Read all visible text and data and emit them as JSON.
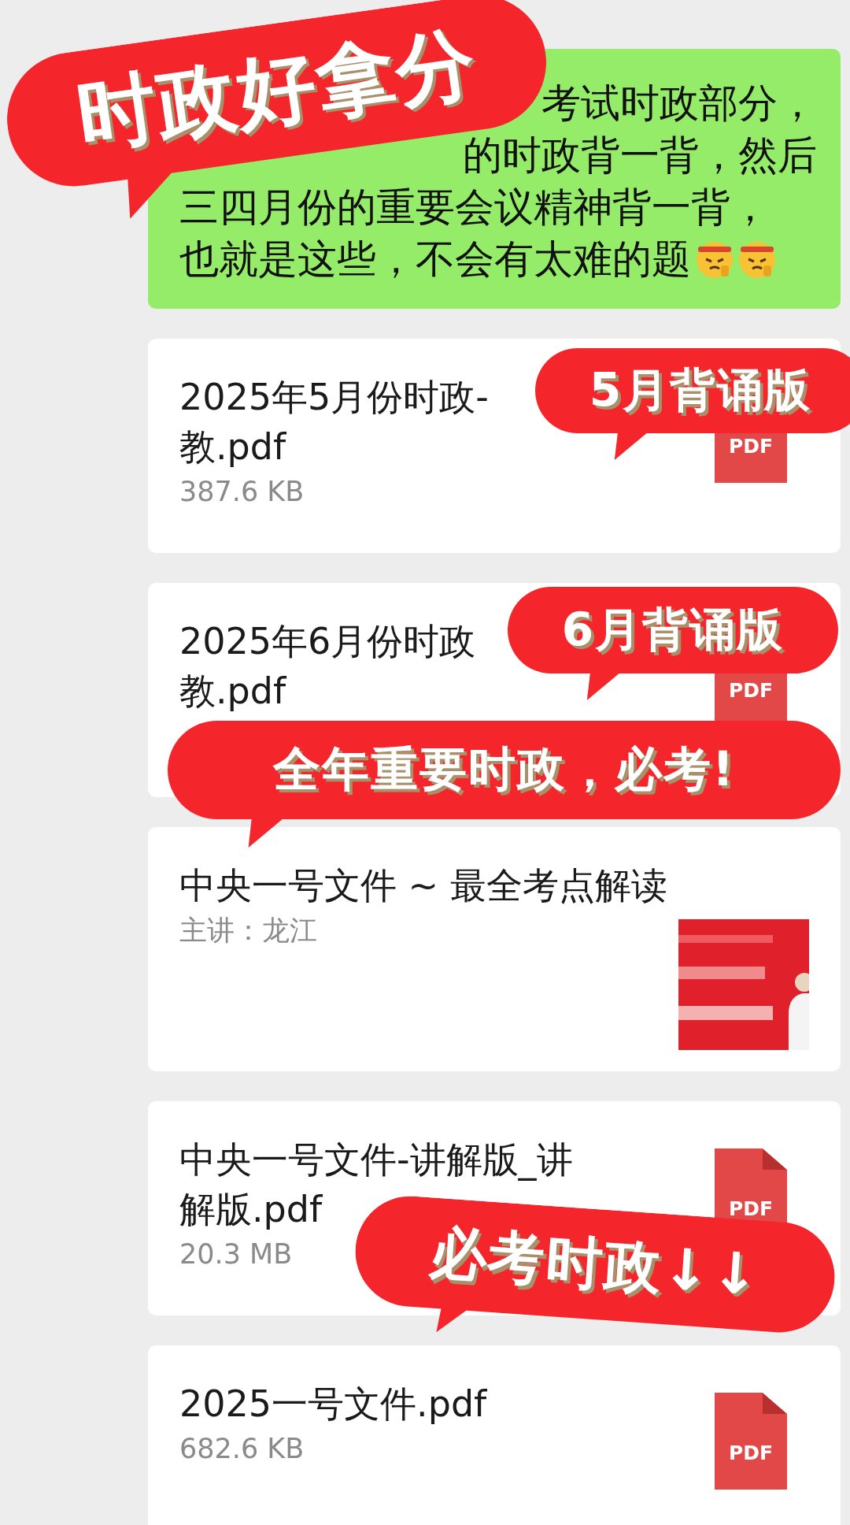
{
  "message": {
    "lines": [
      "考试时政部分，",
      "的时政背一背，然后",
      "三四月份的重要会议精神背一背，",
      "也就是这些，不会有太难的题"
    ]
  },
  "files": [
    {
      "kind": "pdf",
      "title_lines": [
        "2025年5月份时政-",
        "教.pdf"
      ],
      "size": "387.6 KB",
      "icon_label": "PDF"
    },
    {
      "kind": "pdf",
      "title_lines": [
        "2025年6月份时政",
        "教.pdf"
      ],
      "icon_label": "PDF"
    },
    {
      "kind": "link",
      "title_lines": [
        "中央一号文件 ~ 最全考点解读"
      ],
      "subtitle": "主讲：龙江"
    },
    {
      "kind": "pdf",
      "title_lines": [
        "中央一号文件-讲解版_讲",
        "解版.pdf"
      ],
      "size": "20.3 MB",
      "icon_label": "PDF"
    },
    {
      "kind": "pdf",
      "title_lines": [
        "2025一号文件.pdf"
      ],
      "size": "682.6 KB",
      "icon_label": "PDF"
    }
  ],
  "stickers": [
    {
      "text": "时政好拿分"
    },
    {
      "text": "5月背诵版"
    },
    {
      "text": "6月背诵版"
    },
    {
      "text": "全年重要时政，必考!"
    },
    {
      "text": "必考时政↓↓"
    }
  ]
}
